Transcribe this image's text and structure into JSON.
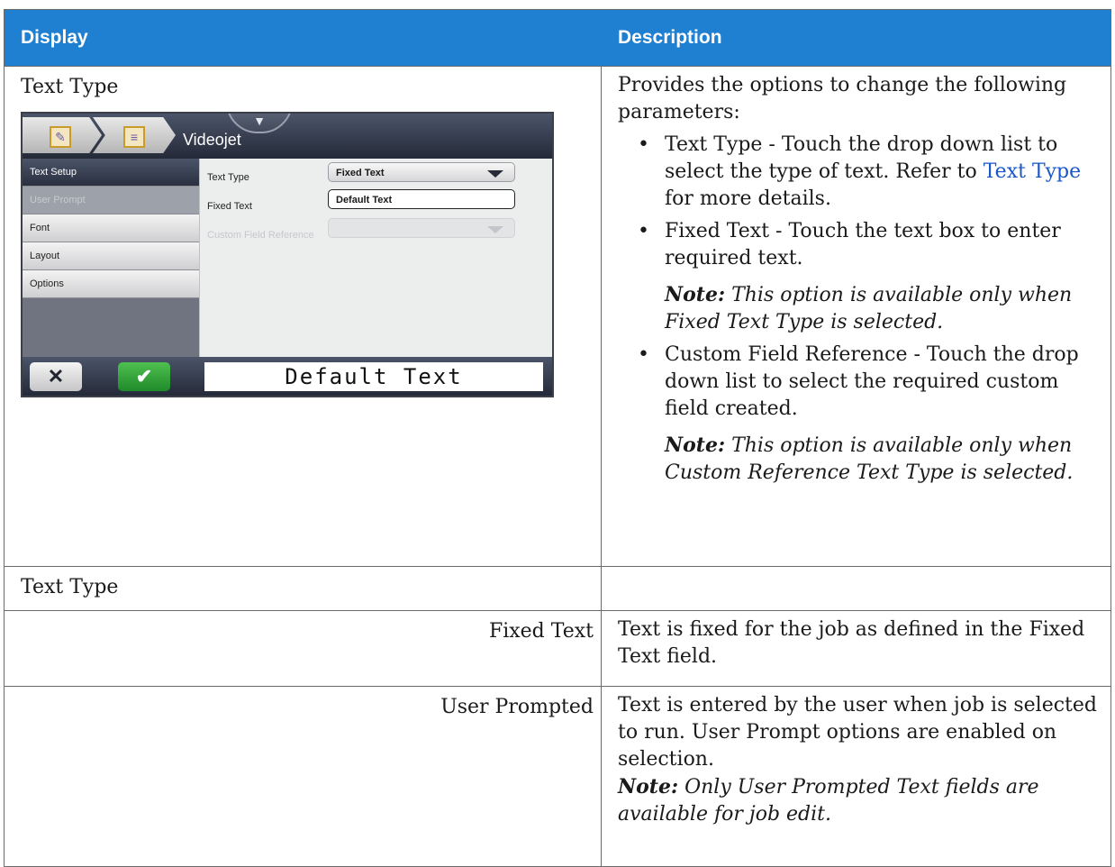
{
  "table": {
    "headers": {
      "display": "Display",
      "description": "Description"
    },
    "row1": {
      "display_title": "Text Type",
      "description_intro": "Provides the options to change the following parameters:",
      "bullet1": {
        "text_before_link": "Text Type - Touch the drop down list to select the type of text. Refer to ",
        "link": "Text Type",
        "text_after_link": " for more details."
      },
      "bullet2": "Fixed Text - Touch the text box to enter required text.",
      "note1": {
        "label": "Note:",
        "text": " This option is available only when Fixed Text Type is selected."
      },
      "bullet3": "Custom Field Reference - Touch the drop down list to select the required custom field created.",
      "note2": {
        "label": "Note:",
        "text": " This option is available only when Custom Reference Text Type is selected."
      }
    },
    "row2": {
      "display": "Text Type",
      "description": ""
    },
    "row3": {
      "display": "Fixed Text",
      "description": "Text is fixed for the job as defined in the Fixed Text field."
    },
    "row4": {
      "display": "User Prompted",
      "description": "Text is entered by the user when job is selected to run. User Prompt options are enabled on selection.",
      "note": {
        "label": "Note:",
        "text": " Only User Prompted Text fields are available for job edit."
      }
    }
  },
  "screenshot": {
    "title": "Videojet",
    "menu": [
      "Text Setup",
      "User Prompt",
      "Font",
      "Layout",
      "Options"
    ],
    "fields": {
      "text_type": {
        "label": "Text Type",
        "value": "Fixed Text"
      },
      "fixed_text": {
        "label": "Fixed Text",
        "value": "Default Text"
      },
      "custom_field_reference": {
        "label": "Custom Field Reference",
        "value": ""
      }
    },
    "preview": "Default Text",
    "icons": {
      "cancel": "close-icon",
      "confirm": "check-icon",
      "handle": "chevron-down-icon",
      "breadcrumb1": "edit-document-icon",
      "breadcrumb2": "document-icon"
    },
    "colors": {
      "header": "#1f7fd0",
      "link": "#1a56c8",
      "ok": "#2ea43a"
    }
  }
}
